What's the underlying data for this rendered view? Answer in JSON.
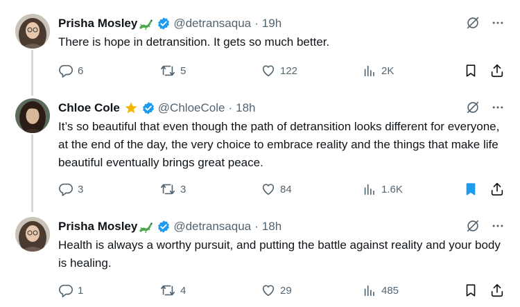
{
  "tweets": [
    {
      "name": "Prisha Mosley",
      "name_emoji": "lizard-emoji",
      "handle": "@detransaqua",
      "separator": "·",
      "time": "19h",
      "text": "There is hope in detransition. It gets so much better.",
      "replies": "6",
      "retweets": "5",
      "likes": "122",
      "views": "2K",
      "bookmarked": false
    },
    {
      "name": "Chloe Cole",
      "name_emoji": "star-emoji",
      "handle": "@ChloeCole",
      "separator": "·",
      "time": "18h",
      "text": "It’s so beautiful that even though the path of detransition looks different for everyone, at the end of the day, the very choice to embrace reality and the things that make life beautiful eventually brings great peace.",
      "replies": "3",
      "retweets": "3",
      "likes": "84",
      "views": "1.6K",
      "bookmarked": true
    },
    {
      "name": "Prisha Mosley",
      "name_emoji": "lizard-emoji",
      "handle": "@detransaqua",
      "separator": "·",
      "time": "18h",
      "text": "Health is always a worthy pursuit, and putting the battle against reality and your body is healing.",
      "replies": "1",
      "retweets": "4",
      "likes": "29",
      "views": "485",
      "bookmarked": false
    }
  ],
  "colors": {
    "verified": "#1d9bf0",
    "muted": "#536471",
    "text": "#0f1419",
    "thread_line": "#cfd9de",
    "bookmark_active": "#1d9bf0",
    "star": "#f4b400",
    "lizard": "#4aa84a"
  }
}
